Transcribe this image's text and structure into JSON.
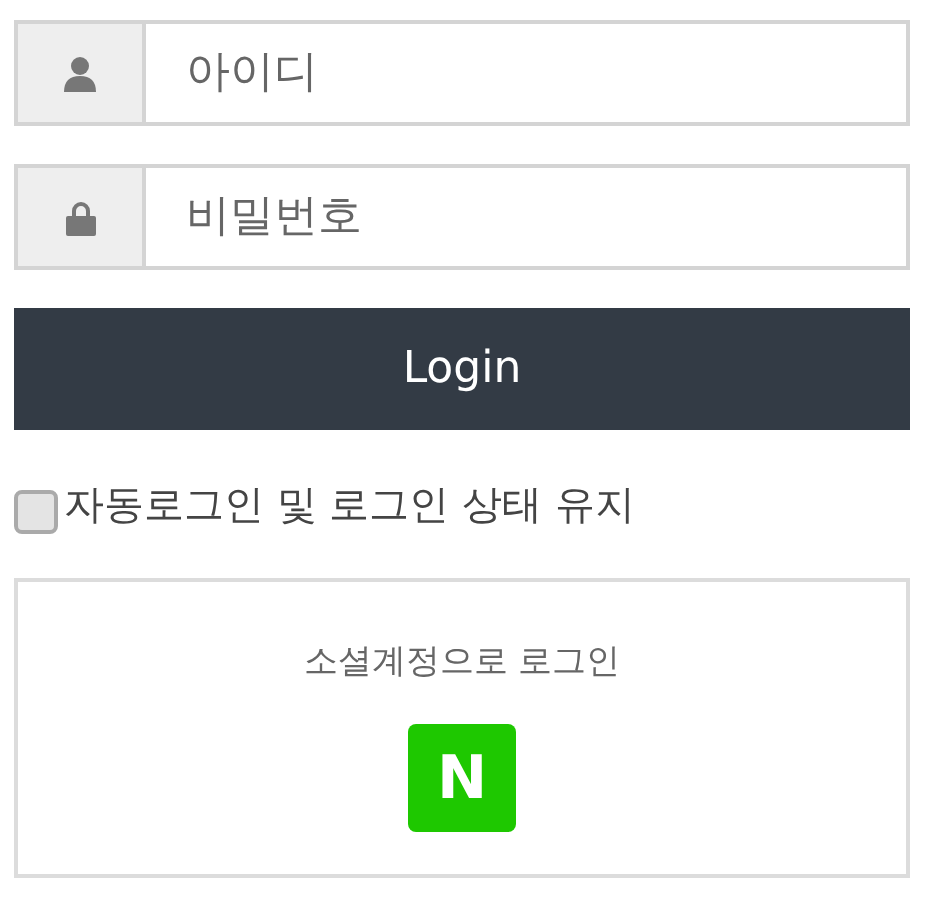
{
  "fields": [
    {
      "kind": "user",
      "placeholder": "아이디"
    },
    {
      "kind": "password",
      "placeholder": "비밀번호"
    }
  ],
  "login_button": "Login",
  "remember": {
    "label": "자동로그인 및 로그인 상태 유지",
    "checked": false
  },
  "social": {
    "title": "소셜계정으로 로그인",
    "buttons": [
      {
        "label": "N",
        "color": "#1ec800"
      }
    ]
  }
}
